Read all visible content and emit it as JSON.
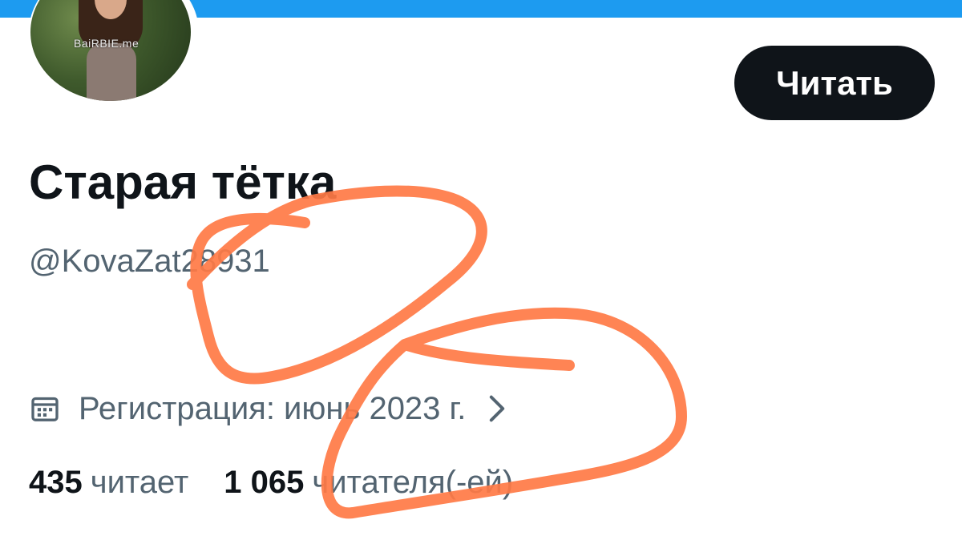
{
  "banner": {
    "color": "#1d9bf0"
  },
  "avatar": {
    "icon": "profile-photo",
    "watermark": "BaiRBIE.me"
  },
  "follow_button": {
    "label": "Читать",
    "bg": "#0f1419"
  },
  "profile": {
    "display_name": "Старая тётка",
    "handle": "@KovaZat28931"
  },
  "joined": {
    "icon": "calendar-icon",
    "text": "Регистрация: июнь 2023 г.",
    "chevron_icon": "chevron-right-icon"
  },
  "stats": {
    "following_count": "435",
    "following_label": "читает",
    "followers_count": "1 065",
    "followers_label": "читателя(-ей)"
  },
  "annotation": {
    "color": "#ff7a45",
    "icon": "hand-drawn-scribble"
  }
}
